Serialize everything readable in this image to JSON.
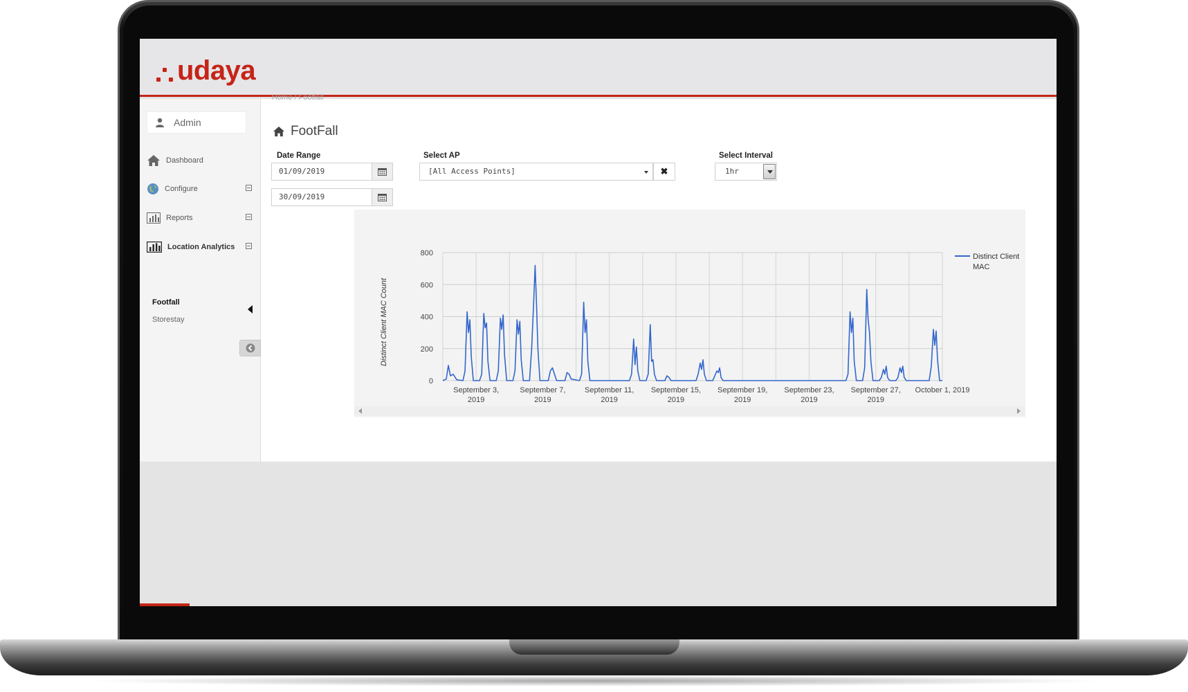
{
  "brand": {
    "name": "udaya",
    "color": "#c52418"
  },
  "user": {
    "name": "Admin",
    "icon": "user-icon"
  },
  "nav": {
    "items": [
      {
        "label": "Dashboard",
        "icon": "home-icon"
      },
      {
        "label": "Configure",
        "icon": "globe-icon"
      },
      {
        "label": "Reports",
        "icon": "bar-chart-icon"
      },
      {
        "label": "Location Analytics",
        "icon": "bar-chart-icon"
      }
    ],
    "sub_items": [
      {
        "label": "Footfall",
        "active": true
      },
      {
        "label": "Storestay",
        "active": false
      }
    ]
  },
  "breadcrumb": "Home / Footfall",
  "page": {
    "title": "FootFall",
    "icon": "home-icon"
  },
  "filters": {
    "date_range_label": "Date Range",
    "date_from": "01/09/2019",
    "date_to": "30/09/2019",
    "ap_label": "Select AP",
    "ap_value": "[All Access Points]",
    "interval_label": "Select Interval",
    "interval_value": "1hr"
  },
  "chart_data": {
    "type": "line",
    "title": "",
    "xlabel": "",
    "ylabel": "Distinct Client MAC Count",
    "ylim": [
      0,
      800
    ],
    "yticks": [
      0,
      200,
      400,
      600,
      800
    ],
    "xlim": [
      "2019-09-01",
      "2019-10-01"
    ],
    "xticks": [
      {
        "date": "2019-09-03",
        "label": [
          "September 3,",
          "2019"
        ]
      },
      {
        "date": "2019-09-07",
        "label": [
          "September 7,",
          "2019"
        ]
      },
      {
        "date": "2019-09-11",
        "label": [
          "September 11,",
          "2019"
        ]
      },
      {
        "date": "2019-09-15",
        "label": [
          "September 15,",
          "2019"
        ]
      },
      {
        "date": "2019-09-19",
        "label": [
          "September 19,",
          "2019"
        ]
      },
      {
        "date": "2019-09-23",
        "label": [
          "September 23,",
          "2019"
        ]
      },
      {
        "date": "2019-09-27",
        "label": [
          "September 27,",
          "2019"
        ]
      },
      {
        "date": "2019-10-01",
        "label": [
          "October 1, 2019"
        ]
      }
    ],
    "grid": true,
    "legend_position": "right",
    "series": [
      {
        "name": "Distinct Client MAC",
        "color": "#3366cc",
        "points": [
          [
            "2019-09-01 00:00",
            0
          ],
          [
            "2019-09-01 05:00",
            10
          ],
          [
            "2019-09-01 08:00",
            95
          ],
          [
            "2019-09-01 11:00",
            30
          ],
          [
            "2019-09-01 15:00",
            40
          ],
          [
            "2019-09-01 20:00",
            5
          ],
          [
            "2019-09-02 05:00",
            0
          ],
          [
            "2019-09-02 08:00",
            60
          ],
          [
            "2019-09-02 11:00",
            430
          ],
          [
            "2019-09-02 13:00",
            300
          ],
          [
            "2019-09-02 15:00",
            380
          ],
          [
            "2019-09-02 17:00",
            150
          ],
          [
            "2019-09-02 20:00",
            0
          ],
          [
            "2019-09-03 05:00",
            0
          ],
          [
            "2019-09-03 08:00",
            40
          ],
          [
            "2019-09-03 11:00",
            420
          ],
          [
            "2019-09-03 13:00",
            330
          ],
          [
            "2019-09-03 15:00",
            360
          ],
          [
            "2019-09-03 17:00",
            120
          ],
          [
            "2019-09-03 20:00",
            0
          ],
          [
            "2019-09-04 05:00",
            0
          ],
          [
            "2019-09-04 08:00",
            60
          ],
          [
            "2019-09-04 11:00",
            390
          ],
          [
            "2019-09-04 13:00",
            320
          ],
          [
            "2019-09-04 15:00",
            410
          ],
          [
            "2019-09-04 17:00",
            160
          ],
          [
            "2019-09-04 20:00",
            0
          ],
          [
            "2019-09-05 05:00",
            0
          ],
          [
            "2019-09-05 08:00",
            60
          ],
          [
            "2019-09-05 11:00",
            380
          ],
          [
            "2019-09-05 13:00",
            290
          ],
          [
            "2019-09-05 15:00",
            370
          ],
          [
            "2019-09-05 17:00",
            130
          ],
          [
            "2019-09-05 20:00",
            0
          ],
          [
            "2019-09-06 05:00",
            0
          ],
          [
            "2019-09-06 08:00",
            200
          ],
          [
            "2019-09-06 11:00",
            500
          ],
          [
            "2019-09-06 13:00",
            720
          ],
          [
            "2019-09-06 15:00",
            480
          ],
          [
            "2019-09-06 17:00",
            200
          ],
          [
            "2019-09-06 20:00",
            0
          ],
          [
            "2019-09-07 08:00",
            0
          ],
          [
            "2019-09-07 11:00",
            60
          ],
          [
            "2019-09-07 14:00",
            80
          ],
          [
            "2019-09-07 17:00",
            40
          ],
          [
            "2019-09-07 20:00",
            0
          ],
          [
            "2019-09-08 08:00",
            0
          ],
          [
            "2019-09-08 11:00",
            50
          ],
          [
            "2019-09-08 14:00",
            40
          ],
          [
            "2019-09-08 17:00",
            10
          ],
          [
            "2019-09-09 05:00",
            0
          ],
          [
            "2019-09-09 08:00",
            40
          ],
          [
            "2019-09-09 11:00",
            490
          ],
          [
            "2019-09-09 13:00",
            300
          ],
          [
            "2019-09-09 15:00",
            380
          ],
          [
            "2019-09-09 17:00",
            120
          ],
          [
            "2019-09-09 20:00",
            0
          ],
          [
            "2019-09-12 05:00",
            0
          ],
          [
            "2019-09-12 08:00",
            40
          ],
          [
            "2019-09-12 11:00",
            260
          ],
          [
            "2019-09-12 13:00",
            100
          ],
          [
            "2019-09-12 15:00",
            210
          ],
          [
            "2019-09-12 17:00",
            60
          ],
          [
            "2019-09-12 20:00",
            0
          ],
          [
            "2019-09-13 05:00",
            0
          ],
          [
            "2019-09-13 08:00",
            40
          ],
          [
            "2019-09-13 11:00",
            350
          ],
          [
            "2019-09-13 13:00",
            120
          ],
          [
            "2019-09-13 15:00",
            130
          ],
          [
            "2019-09-13 17:00",
            40
          ],
          [
            "2019-09-13 20:00",
            0
          ],
          [
            "2019-09-14 08:00",
            0
          ],
          [
            "2019-09-14 11:00",
            30
          ],
          [
            "2019-09-14 14:00",
            20
          ],
          [
            "2019-09-14 17:00",
            0
          ],
          [
            "2019-09-16 05:00",
            0
          ],
          [
            "2019-09-16 08:00",
            40
          ],
          [
            "2019-09-16 11:00",
            110
          ],
          [
            "2019-09-16 13:00",
            70
          ],
          [
            "2019-09-16 15:00",
            130
          ],
          [
            "2019-09-16 17:00",
            40
          ],
          [
            "2019-09-16 20:00",
            0
          ],
          [
            "2019-09-17 05:00",
            0
          ],
          [
            "2019-09-17 08:00",
            30
          ],
          [
            "2019-09-17 11:00",
            60
          ],
          [
            "2019-09-17 13:00",
            50
          ],
          [
            "2019-09-17 15:00",
            80
          ],
          [
            "2019-09-17 17:00",
            20
          ],
          [
            "2019-09-17 20:00",
            0
          ],
          [
            "2019-09-25 05:00",
            0
          ],
          [
            "2019-09-25 08:00",
            40
          ],
          [
            "2019-09-25 11:00",
            430
          ],
          [
            "2019-09-25 13:00",
            300
          ],
          [
            "2019-09-25 15:00",
            390
          ],
          [
            "2019-09-25 17:00",
            120
          ],
          [
            "2019-09-25 20:00",
            0
          ],
          [
            "2019-09-26 05:00",
            0
          ],
          [
            "2019-09-26 08:00",
            80
          ],
          [
            "2019-09-26 11:00",
            570
          ],
          [
            "2019-09-26 13:00",
            380
          ],
          [
            "2019-09-26 15:00",
            300
          ],
          [
            "2019-09-26 17:00",
            120
          ],
          [
            "2019-09-26 20:00",
            0
          ],
          [
            "2019-09-27 05:00",
            0
          ],
          [
            "2019-09-27 08:00",
            20
          ],
          [
            "2019-09-27 11:00",
            70
          ],
          [
            "2019-09-27 13:00",
            40
          ],
          [
            "2019-09-27 15:00",
            90
          ],
          [
            "2019-09-27 17:00",
            20
          ],
          [
            "2019-09-27 20:00",
            0
          ],
          [
            "2019-09-28 05:00",
            0
          ],
          [
            "2019-09-28 08:00",
            20
          ],
          [
            "2019-09-28 11:00",
            80
          ],
          [
            "2019-09-28 13:00",
            50
          ],
          [
            "2019-09-28 15:00",
            90
          ],
          [
            "2019-09-28 17:00",
            20
          ],
          [
            "2019-09-28 20:00",
            0
          ],
          [
            "2019-09-30 05:00",
            0
          ],
          [
            "2019-09-30 08:00",
            90
          ],
          [
            "2019-09-30 11:00",
            320
          ],
          [
            "2019-09-30 13:00",
            220
          ],
          [
            "2019-09-30 15:00",
            310
          ],
          [
            "2019-09-30 17:00",
            130
          ],
          [
            "2019-09-30 20:00",
            0
          ],
          [
            "2019-10-01 00:00",
            0
          ]
        ]
      }
    ]
  }
}
